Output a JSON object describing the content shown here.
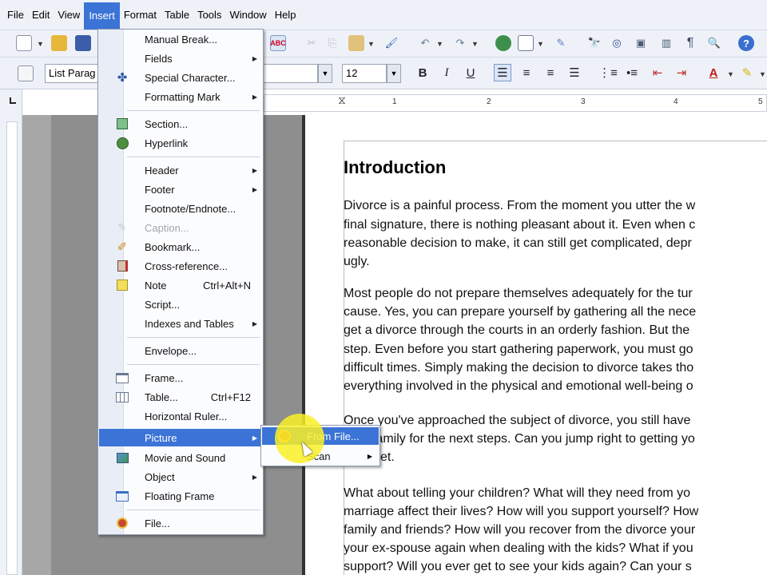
{
  "menubar": {
    "items": [
      "File",
      "Edit",
      "View",
      "Insert",
      "Format",
      "Table",
      "Tools",
      "Window",
      "Help"
    ],
    "active": "Insert"
  },
  "format_toolbar": {
    "style_value": "List Parag",
    "font_size": "12",
    "bold_label": "B",
    "italic_label": "I",
    "underline_label": "U",
    "font_color_label": "A"
  },
  "ruler": {
    "numbers": [
      "1",
      "2",
      "3",
      "4",
      "5"
    ]
  },
  "insert_menu": {
    "items": [
      {
        "label": "Manual Break...",
        "icon": "",
        "arrow": false
      },
      {
        "label": "Fields",
        "icon": "",
        "arrow": true
      },
      {
        "label": "Special Character...",
        "icon": "special-character-icon",
        "arrow": false
      },
      {
        "label": "Formatting Mark",
        "icon": "",
        "arrow": true
      },
      {
        "label": "Section...",
        "icon": "section-icon",
        "arrow": false
      },
      {
        "label": "Hyperlink",
        "icon": "hyperlink-globe-icon",
        "arrow": false
      },
      {
        "label": "Header",
        "icon": "",
        "arrow": true
      },
      {
        "label": "Footer",
        "icon": "",
        "arrow": true
      },
      {
        "label": "Footnote/Endnote...",
        "icon": "",
        "arrow": false
      },
      {
        "label": "Caption...",
        "icon": "caption-icon",
        "arrow": false,
        "disabled": true
      },
      {
        "label": "Bookmark...",
        "icon": "bookmark-icon",
        "arrow": false
      },
      {
        "label": "Cross-reference...",
        "icon": "cross-reference-icon",
        "arrow": false
      },
      {
        "label": "Note",
        "icon": "note-icon",
        "arrow": false,
        "shortcut": "Ctrl+Alt+N"
      },
      {
        "label": "Script...",
        "icon": "",
        "arrow": false
      },
      {
        "label": "Indexes and Tables",
        "icon": "",
        "arrow": true
      },
      {
        "label": "Envelope...",
        "icon": "",
        "arrow": false
      },
      {
        "label": "Frame...",
        "icon": "frame-icon",
        "arrow": false
      },
      {
        "label": "Table...",
        "icon": "table-icon",
        "arrow": false,
        "shortcut": "Ctrl+F12"
      },
      {
        "label": "Horizontal Ruler...",
        "icon": "",
        "arrow": false
      },
      {
        "label": "Picture",
        "icon": "",
        "arrow": true,
        "highlight": true
      },
      {
        "label": "Movie and Sound",
        "icon": "movie-icon",
        "arrow": false
      },
      {
        "label": "Object",
        "icon": "",
        "arrow": true
      },
      {
        "label": "Floating Frame",
        "icon": "floating-frame-icon",
        "arrow": false
      },
      {
        "label": "File...",
        "icon": "file-icon",
        "arrow": false
      }
    ]
  },
  "picture_submenu": {
    "from_file": "From File...",
    "scan": "Scan"
  },
  "document": {
    "heading": "Introduction",
    "lines": [
      "Divorce is a painful process. From the moment you utter the w",
      "final signature, there is nothing pleasant about it. Even when c",
      "reasonable decision to make, it can still get complicated, depr",
      "ugly.",
      "Most people do not prepare themselves adequately for the tur",
      "cause. Yes, you can prepare yourself by gathering all the nece",
      "get a divorce through the courts in an orderly fashion. But the",
      "step. Even before you start gathering paperwork, you must go",
      "difficult times. Simply making the decision to divorce takes tho",
      "everything involved in the physical and emotional well-being o",
      "Once you've approached the subject of divorce, you still have",
      "family for the next steps. Can you jump right to getting yo",
      "et.",
      "What about telling your children? What will they need from yo",
      "marriage affect their lives? How will you support yourself? How",
      "family and friends? How will you recover from the divorce your",
      "your ex-spouse again when dealing with the kids? What if you",
      "support? Will you ever get to see your kids again? Can your s"
    ]
  },
  "colors": {
    "menu_highlight": "#3b74d6",
    "toolbar_bg": "#eef2f8",
    "cursor_highlight": "#faf028"
  }
}
